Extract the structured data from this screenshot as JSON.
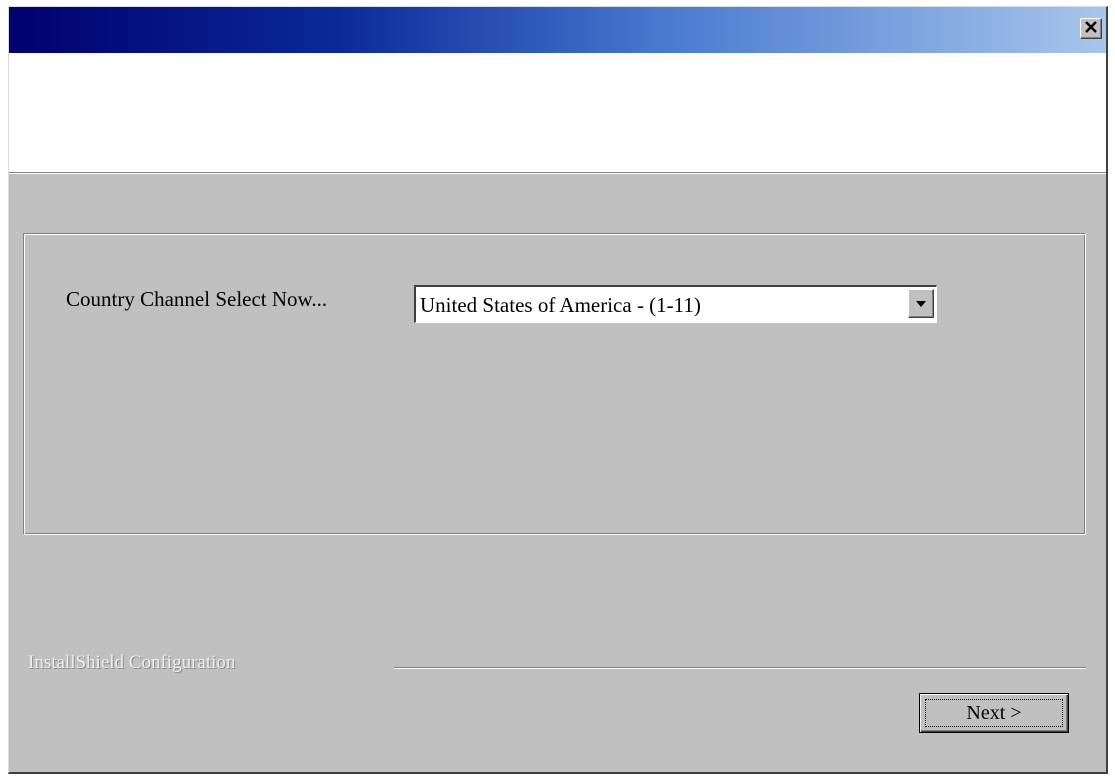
{
  "window": {
    "title": "",
    "colors": {
      "titlebar_start": "#00006e",
      "titlebar_end": "#a8c6ec",
      "face": "#c0c0c0"
    }
  },
  "titlebar": {
    "close_icon": "close-icon"
  },
  "country_channel": {
    "label": "Country Channel Select Now...",
    "selected": "United States of America - (1-11)",
    "dropdown_icon": "chevron-down-icon"
  },
  "footer": {
    "brand": "InstallShield Configuration",
    "next_label": "Next >"
  }
}
